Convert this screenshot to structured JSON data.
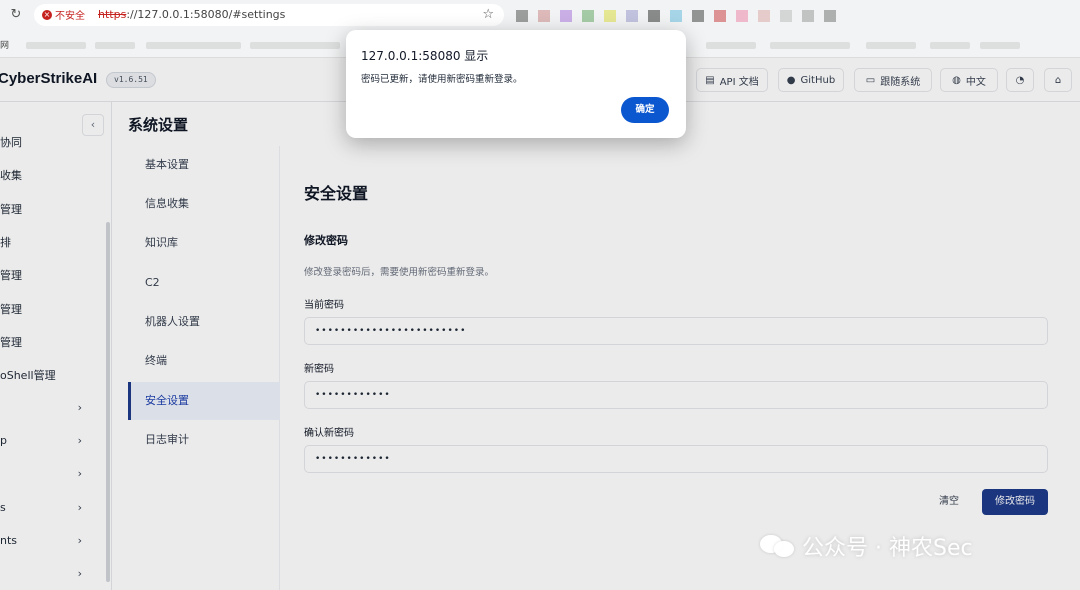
{
  "browser": {
    "insecure_label": "不安全",
    "url_scheme": "https",
    "url_rest": "://127.0.0.1:58080/#settings",
    "bookmark_label": "网"
  },
  "topbar": {
    "brand": "CyberStrikeAI",
    "version": "v1.6.51",
    "buttons": [
      {
        "label": "API 文档",
        "icon": "document-icon"
      },
      {
        "label": "GitHub",
        "icon": "github-icon"
      },
      {
        "label": "跟随系统",
        "icon": "monitor-icon"
      },
      {
        "label": "中文",
        "icon": "globe-icon"
      }
    ]
  },
  "sidebar": {
    "items": [
      {
        "label": "协同"
      },
      {
        "label": "收集"
      },
      {
        "label": "管理"
      },
      {
        "label": "排"
      },
      {
        "label": "管理"
      },
      {
        "label": "管理"
      },
      {
        "label": "管理"
      },
      {
        "label": "oShell管理"
      },
      {
        "label": ""
      },
      {
        "label": "p"
      },
      {
        "label": ""
      },
      {
        "label": "s"
      },
      {
        "label": "nts"
      },
      {
        "label": ""
      }
    ]
  },
  "page": {
    "title": "系统设置"
  },
  "settings_nav": {
    "items": [
      {
        "label": "基本设置",
        "active": false
      },
      {
        "label": "信息收集",
        "active": false
      },
      {
        "label": "知识库",
        "active": false
      },
      {
        "label": "C2",
        "active": false
      },
      {
        "label": "机器人设置",
        "active": false
      },
      {
        "label": "终端",
        "active": false
      },
      {
        "label": "安全设置",
        "active": true
      },
      {
        "label": "日志审计",
        "active": false
      }
    ]
  },
  "security": {
    "title": "安全设置",
    "subtitle": "修改密码",
    "hint": "修改登录密码后，需要使用新密码重新登录。",
    "current_label": "当前密码",
    "current_value": "••••••••••••••••••••••••",
    "new_label": "新密码",
    "new_value": "••••••••••••",
    "confirm_label": "确认新密码",
    "confirm_value": "••••••••••••",
    "clear_label": "清空",
    "submit_label": "修改密码"
  },
  "dialog": {
    "title": "127.0.0.1:58080 显示",
    "message": "密码已更新，请使用新密码重新登录。",
    "ok_label": "确定"
  },
  "watermark": {
    "text": "公众号 · 神农Sec"
  },
  "colors": {
    "accent": "#1e3a8a",
    "dialog_button": "#0b57d0",
    "insecure": "#c5221f"
  }
}
